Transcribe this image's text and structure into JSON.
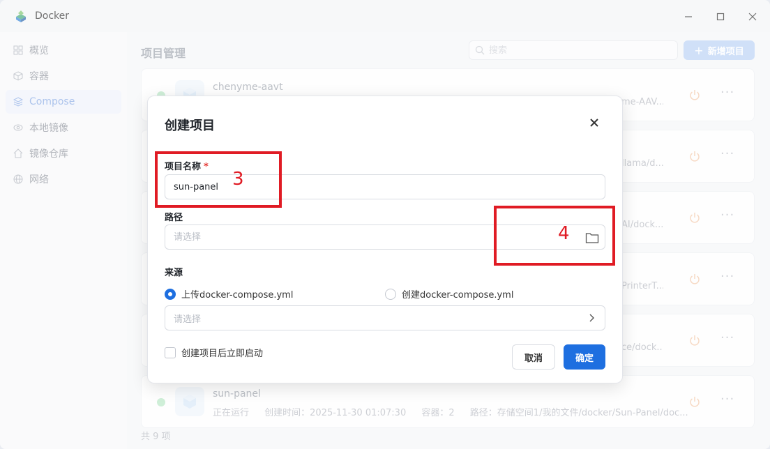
{
  "window": {
    "title": "Docker"
  },
  "sidebar": {
    "items": [
      {
        "label": "概览",
        "icon": "grid-icon"
      },
      {
        "label": "容器",
        "icon": "cube-icon"
      },
      {
        "label": "Compose",
        "icon": "layers-icon",
        "active": true
      },
      {
        "label": "本地镜像",
        "icon": "eye-icon"
      },
      {
        "label": "镜像仓库",
        "icon": "home-icon"
      },
      {
        "label": "网络",
        "icon": "globe-icon"
      }
    ]
  },
  "main": {
    "title": "项目管理",
    "search_placeholder": "搜索",
    "add_button": "新增项目",
    "projects": [
      {
        "name": "chenyme-aavt",
        "path_tail": "me-AAV..."
      },
      {
        "name": "",
        "path_tail": "llama/d..."
      },
      {
        "name": "",
        "path_tail": "AI/dock..."
      },
      {
        "name": "",
        "path_tail": "PrinterT..."
      },
      {
        "name": "",
        "path_tail": "ce/dock..."
      },
      {
        "name": "sun-panel",
        "status": "正在运行",
        "created": "创建时间：2025-11-30 01:07:30",
        "containers": "容器：2",
        "path": "路径：存储空间1/我的文件/docker/Sun-Panel/doc..."
      }
    ],
    "footer": "共 9 项"
  },
  "dialog": {
    "title": "创建项目",
    "name_label": "项目名称",
    "required_mark": "*",
    "name_value": "sun-panel",
    "path_label": "路径",
    "path_placeholder": "请选择",
    "source_label": "来源",
    "radio_upload": "上传docker-compose.yml",
    "radio_create": "创建docker-compose.yml",
    "source_placeholder": "请选择",
    "autostart_label": "创建项目后立即启动",
    "cancel": "取消",
    "ok": "确定"
  },
  "annotations": {
    "label_3": "3",
    "label_4": "4"
  },
  "colors": {
    "accent": "#1e6fe0",
    "annotation": "#e01b24",
    "running": "#b6e6c3"
  }
}
